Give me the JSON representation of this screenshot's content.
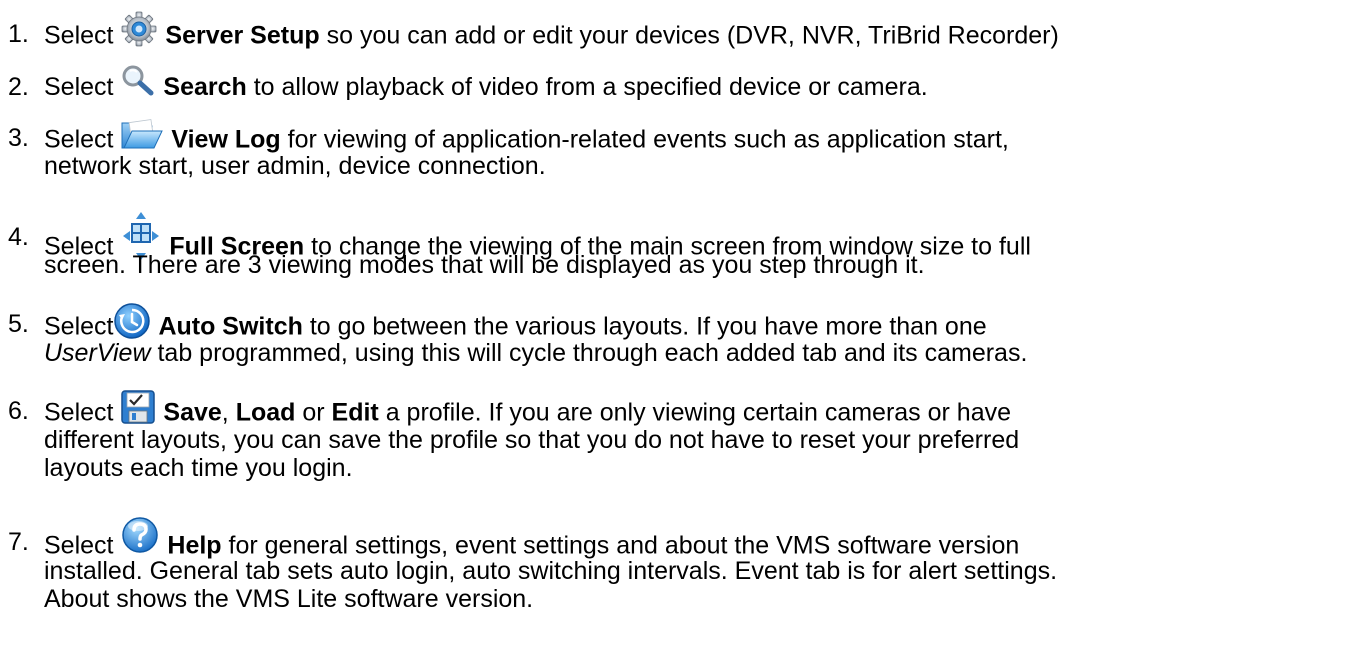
{
  "items": [
    {
      "number": "1.",
      "select": "Select",
      "icon": "gear-icon",
      "label": "Server Setup",
      "text": "so you can add or edit your devices (DVR, NVR, TriBrid Recorder)"
    },
    {
      "number": "2.",
      "select": "Select",
      "icon": "magnifier-icon",
      "label": "Search",
      "text": "to allow playback of video from a specified device or camera."
    },
    {
      "number": "3.",
      "select": "Select",
      "icon": "folder-icon",
      "label": "View Log",
      "text": "for viewing of application-related events such as application start,",
      "text2": "network start, user admin, device connection."
    },
    {
      "number": "4.",
      "select": "Select",
      "icon": "fullscreen-icon",
      "label": "Full Screen",
      "text": "to change the viewing of the main screen from window size to full",
      "text2": "screen.  There are 3 viewing modes that will be displayed as you step through it."
    },
    {
      "number": "5.",
      "select": "Select",
      "icon": "auto-switch-icon",
      "label": "Auto Switch",
      "text": "to go between the various layouts. If you have more than one",
      "italic": "UserView",
      "text2": "tab programmed, using this will cycle through each added tab and its cameras."
    },
    {
      "number": "6.",
      "select": "Select",
      "icon": "save-icon",
      "label": "Save",
      "sep1": ", ",
      "label2": "Load",
      "sep2": " or ",
      "label3": "Edit",
      "text": "a profile.  If you are only viewing certain cameras or have",
      "text2": "different layouts, you can save the profile so that you do not have to reset your preferred",
      "text3": "layouts each time you login."
    },
    {
      "number": "7.",
      "select": "Select",
      "icon": "help-icon",
      "label": "Help",
      "text": "for general settings, event settings and about the VMS software version",
      "text2": "installed. General tab sets auto login, auto switching intervals. Event tab is for alert settings.",
      "text3": "About shows the VMS Lite software version."
    }
  ]
}
